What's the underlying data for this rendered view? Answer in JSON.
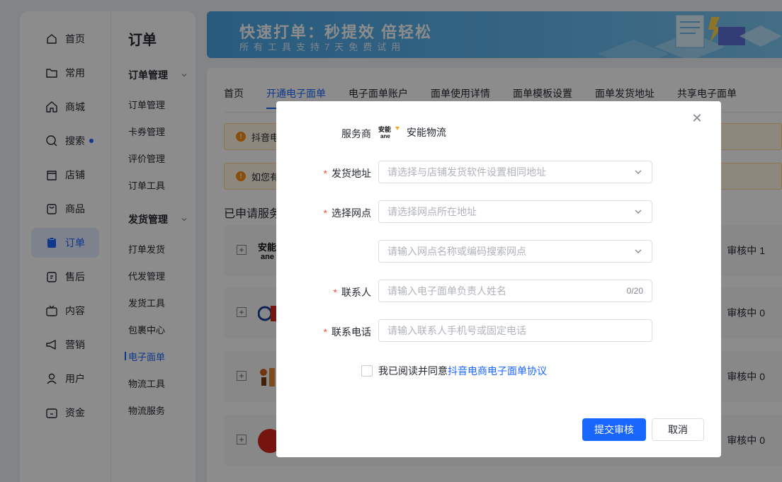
{
  "nav": {
    "items": [
      {
        "label": "首页",
        "icon": "home-icon"
      },
      {
        "label": "常用",
        "icon": "folder-icon"
      },
      {
        "label": "商城",
        "icon": "shop-icon"
      },
      {
        "label": "搜索",
        "icon": "search-chart-icon"
      },
      {
        "label": "店铺",
        "icon": "store-icon"
      },
      {
        "label": "商品",
        "icon": "bag-icon"
      },
      {
        "label": "订单",
        "icon": "order-icon"
      },
      {
        "label": "售后",
        "icon": "aftersale-icon"
      },
      {
        "label": "内容",
        "icon": "tv-icon"
      },
      {
        "label": "营销",
        "icon": "megaphone-icon"
      },
      {
        "label": "用户",
        "icon": "user-icon"
      },
      {
        "label": "资金",
        "icon": "wallet-icon"
      }
    ],
    "active": "订单"
  },
  "subnav": {
    "title": "订单",
    "group1": "订单管理",
    "group1_items": [
      "订单管理",
      "卡券管理",
      "评价管理",
      "订单工具"
    ],
    "group2": "发货管理",
    "group2_items": [
      "打单发货",
      "代发管理",
      "发货工具",
      "包裹中心",
      "电子面单",
      "物流工具",
      "物流服务"
    ],
    "active": "电子面单"
  },
  "banner": {
    "title": "快速打单：秒提效 倍轻松",
    "subtitle": "所有工具支持7天免费试用"
  },
  "tabs": [
    "首页",
    "开通电子面单",
    "电子面单账户",
    "面单使用详情",
    "面单模板设置",
    "面单发货地址",
    "共享电子面单"
  ],
  "notices": [
    "抖音电",
    "如您有"
  ],
  "section_title": "已申请服务",
  "services": [
    {
      "status": "审核中 1"
    },
    {
      "status": "审核中 0"
    },
    {
      "status": "审核中 0"
    },
    {
      "status": "审核中 0"
    }
  ],
  "modal": {
    "provider_label": "服务商",
    "provider_name": "安能物流",
    "fields": {
      "address": {
        "label": "发货地址",
        "placeholder": "请选择与店铺发货软件设置相同地址"
      },
      "outlet": {
        "label": "选择网点",
        "placeholder": "请选择网点所在地址"
      },
      "outlet_search": {
        "placeholder": "请输入网点名称或编码搜索网点"
      },
      "contact": {
        "label": "联系人",
        "placeholder": "请输入电子面单负责人姓名",
        "count": "0/20"
      },
      "phone": {
        "label": "联系电话",
        "placeholder": "请输入联系人手机号或固定电话"
      }
    },
    "agree_text": "我已阅读并同意",
    "agree_link": "抖音电商电子面单协议",
    "submit": "提交审核",
    "cancel": "取消"
  },
  "colors": {
    "primary": "#1966ff",
    "required": "#f54a45",
    "warning": "#fa8c16"
  }
}
